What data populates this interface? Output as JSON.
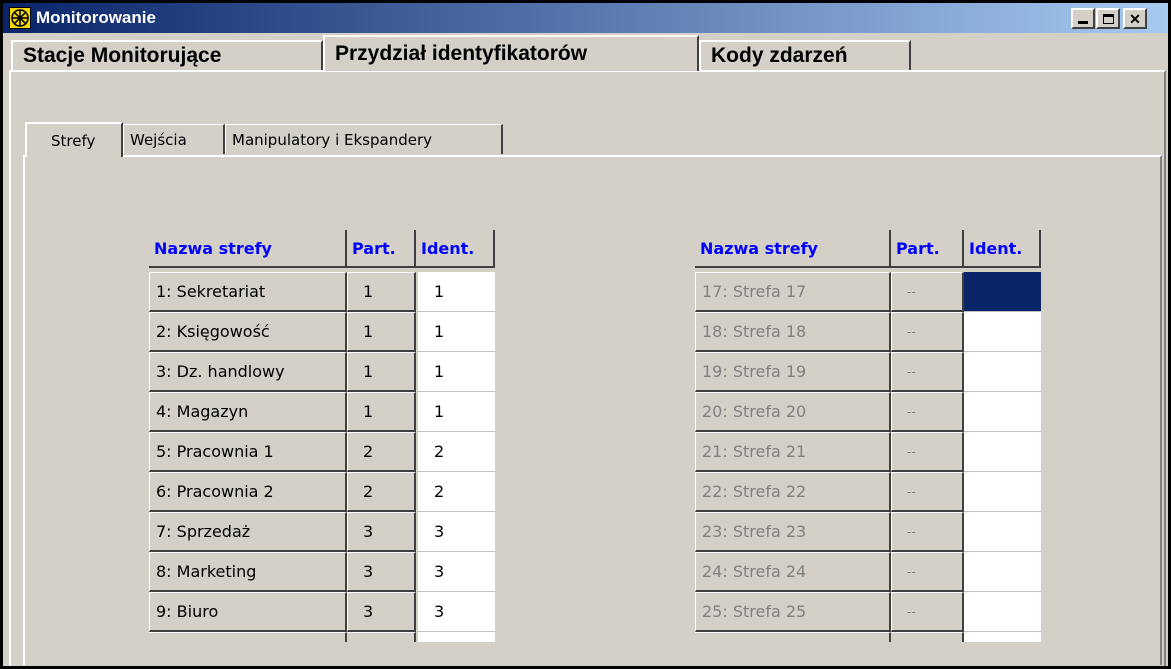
{
  "window": {
    "title": "Monitorowanie"
  },
  "main_tabs": [
    {
      "label": "Stacje Monitorujące",
      "active": false
    },
    {
      "label": "Przydział identyfikatorów",
      "active": true
    },
    {
      "label": "Kody zdarzeń",
      "active": false
    }
  ],
  "sub_tabs": [
    {
      "label": "Strefy",
      "active": true
    },
    {
      "label": "Wejścia",
      "active": false
    },
    {
      "label": "Manipulatory i Ekspandery",
      "active": false
    }
  ],
  "table_left": {
    "headers": [
      "Nazwa strefy",
      "Part.",
      "Ident."
    ],
    "rows": [
      [
        "1: Sekretariat",
        "1",
        "1"
      ],
      [
        "2: Księgowość",
        "1",
        "1"
      ],
      [
        "3: Dz. handlowy",
        "1",
        "1"
      ],
      [
        "4: Magazyn",
        "1",
        "1"
      ],
      [
        "5: Pracownia 1",
        "2",
        "2"
      ],
      [
        "6: Pracownia 2",
        "2",
        "2"
      ],
      [
        "7: Sprzedaż",
        "3",
        "3"
      ],
      [
        "8: Marketing",
        "3",
        "3"
      ],
      [
        "9: Biuro",
        "3",
        "3"
      ]
    ]
  },
  "table_right": {
    "headers": [
      "Nazwa strefy",
      "Part.",
      "Ident."
    ],
    "rows": [
      [
        "17: Strefa 17",
        "--",
        ""
      ],
      [
        "18: Strefa 18",
        "--",
        ""
      ],
      [
        "19: Strefa 19",
        "--",
        ""
      ],
      [
        "20: Strefa 20",
        "--",
        ""
      ],
      [
        "21: Strefa 21",
        "--",
        ""
      ],
      [
        "22: Strefa 22",
        "--",
        ""
      ],
      [
        "23: Strefa 23",
        "--",
        ""
      ],
      [
        "24: Strefa 24",
        "--",
        ""
      ],
      [
        "25: Strefa 25",
        "--",
        ""
      ]
    ],
    "selected_row": 0
  },
  "colors": {
    "title_start": "#0a246a",
    "title_end": "#a6caf0",
    "header_text": "#0000ff",
    "face": "#d4d0c8",
    "selection": "#0a246a"
  },
  "icons": {
    "app": "monitor-wheel-icon",
    "minimize": "minimize-icon",
    "maximize": "maximize-icon",
    "close": "close-icon"
  }
}
